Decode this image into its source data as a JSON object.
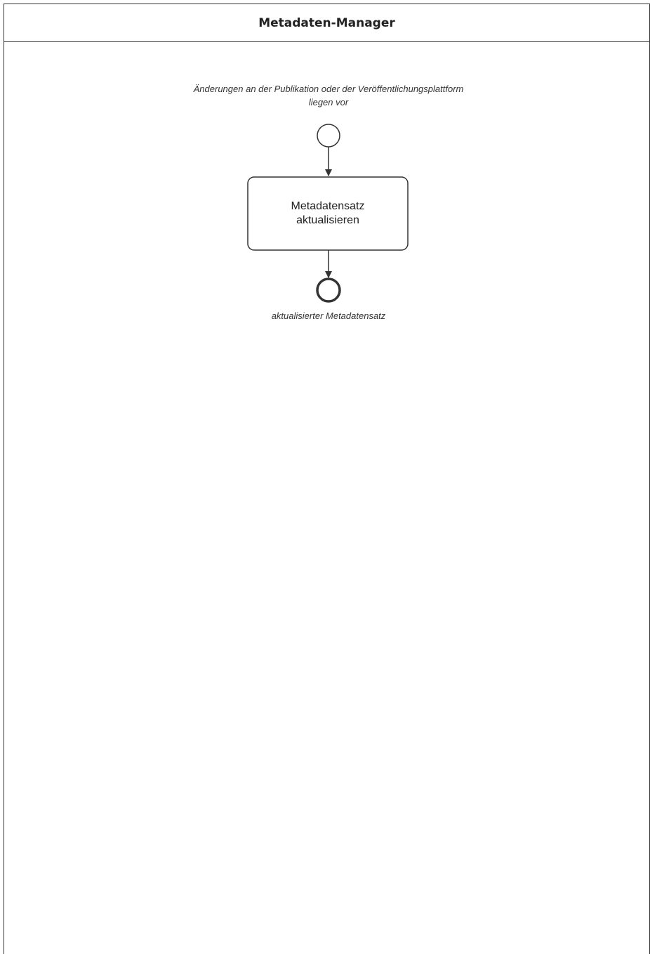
{
  "lane": {
    "title": "Metadaten-Manager"
  },
  "start_event": {
    "label": "Änderungen an der Publikation oder der Veröffentlichungsplattform liegen vor"
  },
  "task": {
    "label": "Metadatensatz aktualisieren"
  },
  "end_event": {
    "label": "aktualisierter Metadatensatz"
  },
  "colors": {
    "stroke": "#333333",
    "background": "#ffffff"
  }
}
